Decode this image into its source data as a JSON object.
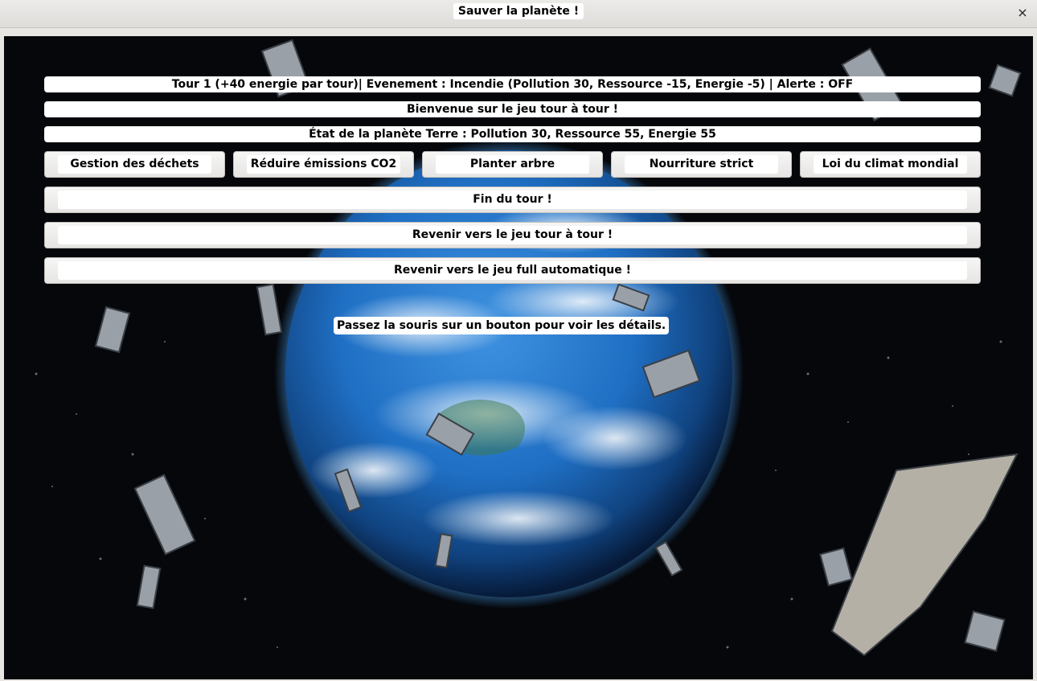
{
  "window": {
    "title": "Sauver la planète !",
    "close_icon": "×"
  },
  "status": {
    "turn_line": "Tour 1 (+40 energie par tour)| Evenement : Incendie (Pollution 30, Ressource -15, Energie -5) | Alerte : OFF",
    "welcome_line": "Bienvenue sur le jeu tour à tour !",
    "planet_line": "État de la planète Terre : Pollution 30, Ressource 55, Energie 55"
  },
  "actions": [
    {
      "label": "Gestion des déchets"
    },
    {
      "label": "Réduire émissions CO2"
    },
    {
      "label": "Planter arbre"
    },
    {
      "label": "Nourriture strict"
    },
    {
      "label": "Loi du climat mondial"
    }
  ],
  "controls": {
    "end_turn": "Fin du tour !",
    "back_turn_based": "Revenir vers le jeu tour à tour !",
    "back_full_auto": "Revenir vers le jeu full automatique !"
  },
  "hint": "Passez la souris sur un bouton pour voir les détails.",
  "colors": {
    "space": "#05070b",
    "ocean": "#1f6fc4",
    "atmosphere_glow": "#4aa8ff",
    "debris": "#9aa0a8"
  }
}
